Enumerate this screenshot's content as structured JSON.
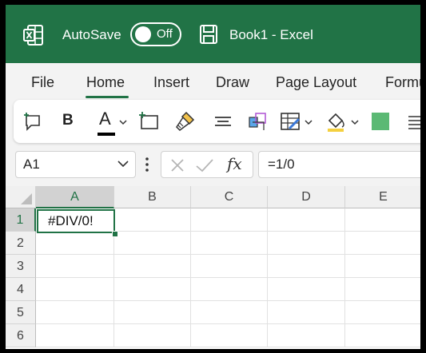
{
  "titlebar": {
    "autosave_label": "AutoSave",
    "toggle_state": "Off",
    "book_title": "Book1  -  Excel",
    "brand_color": "#217346"
  },
  "menu": {
    "tabs": [
      "File",
      "Home",
      "Insert",
      "Draw",
      "Page Layout",
      "Formulas"
    ],
    "active_tab": "Home"
  },
  "ribbon": {
    "icons": [
      "new-comment-icon",
      "bold-icon",
      "font-color-icon",
      "insert-comment-icon",
      "format-painter-icon",
      "align-center-icon",
      "3d-model-icon",
      "format-table-icon",
      "fill-color-icon",
      "color-swatch-icon",
      "align-justify-icon"
    ],
    "bold_label": "B",
    "font_color_label": "A",
    "swatch_color": "#5bb974"
  },
  "formula_bar": {
    "name_box": "A1",
    "fx_label": "fx",
    "formula": "=1/0"
  },
  "sheet": {
    "columns": [
      "A",
      "B",
      "C",
      "D",
      "E"
    ],
    "rows": [
      "1",
      "2",
      "3",
      "4",
      "5",
      "6"
    ],
    "active_cell": "A1",
    "cells": {
      "A1": "#DIV/0!"
    }
  }
}
